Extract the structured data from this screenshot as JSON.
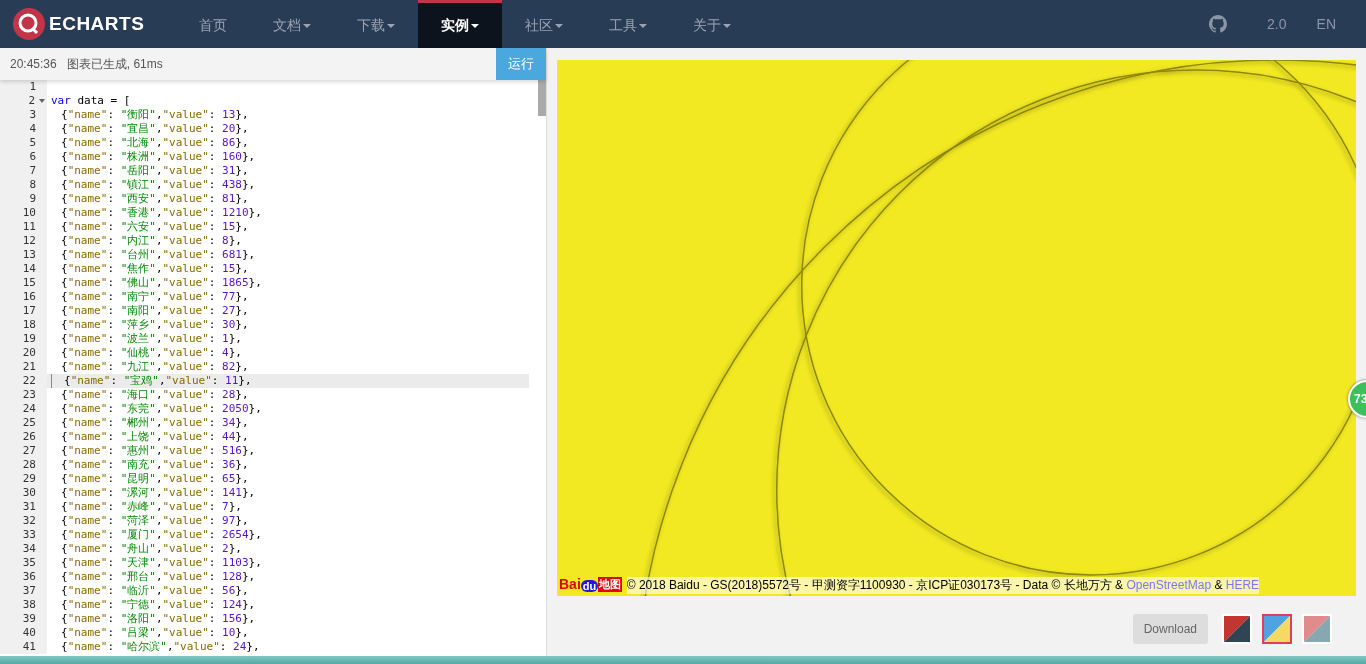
{
  "nav": {
    "logo": "ECHARTS",
    "items": [
      {
        "label": "首页",
        "dropdown": false,
        "selected": false
      },
      {
        "label": "文档",
        "dropdown": true,
        "selected": false
      },
      {
        "label": "下载",
        "dropdown": true,
        "selected": false
      },
      {
        "label": "实例",
        "dropdown": true,
        "selected": true
      },
      {
        "label": "社区",
        "dropdown": true,
        "selected": false
      },
      {
        "label": "工具",
        "dropdown": true,
        "selected": false
      },
      {
        "label": "关于",
        "dropdown": true,
        "selected": false
      }
    ],
    "version": "2.0",
    "language": "EN"
  },
  "status": {
    "time": "20:45:36",
    "message": "图表已生成, 61ms",
    "run_button": "运行"
  },
  "editor": {
    "lines": [
      {
        "n": "1",
        "active": false,
        "foldable": false
      },
      {
        "n": "2",
        "active": false,
        "foldable": true,
        "t": [
          {
            "kind": "keyword",
            "text": "var"
          },
          {
            "kind": "plain",
            "text": " data = ["
          }
        ]
      },
      {
        "n": "3",
        "active": false,
        "foldable": false,
        "t": [
          {
            "kind": "plain",
            "text": "{"
          },
          {
            "kind": "key",
            "text": "\"name\""
          },
          {
            "kind": "plain",
            "text": ": "
          },
          {
            "kind": "string",
            "text": "\"衡阳\""
          },
          {
            "kind": "plain",
            "text": ","
          },
          {
            "kind": "key",
            "text": "\"value\""
          },
          {
            "kind": "plain",
            "text": ": "
          },
          {
            "kind": "number",
            "text": "13"
          },
          {
            "kind": "plain",
            "text": "},"
          }
        ]
      },
      {
        "n": "4",
        "active": false,
        "foldable": false,
        "t": [
          {
            "kind": "plain",
            "text": "{"
          },
          {
            "kind": "key",
            "text": "\"name\""
          },
          {
            "kind": "plain",
            "text": ": "
          },
          {
            "kind": "string",
            "text": "\"宜昌\""
          },
          {
            "kind": "plain",
            "text": ","
          },
          {
            "kind": "key",
            "text": "\"value\""
          },
          {
            "kind": "plain",
            "text": ": "
          },
          {
            "kind": "number",
            "text": "20"
          },
          {
            "kind": "plain",
            "text": "},"
          }
        ]
      },
      {
        "n": "5",
        "active": false,
        "foldable": false,
        "t": [
          {
            "kind": "plain",
            "text": "{"
          },
          {
            "kind": "key",
            "text": "\"name\""
          },
          {
            "kind": "plain",
            "text": ": "
          },
          {
            "kind": "string",
            "text": "\"北海\""
          },
          {
            "kind": "plain",
            "text": ","
          },
          {
            "kind": "key",
            "text": "\"value\""
          },
          {
            "kind": "plain",
            "text": ": "
          },
          {
            "kind": "number",
            "text": "86"
          },
          {
            "kind": "plain",
            "text": "},"
          }
        ]
      },
      {
        "n": "6",
        "active": false,
        "foldable": false,
        "t": [
          {
            "kind": "plain",
            "text": "{"
          },
          {
            "kind": "key",
            "text": "\"name\""
          },
          {
            "kind": "plain",
            "text": ": "
          },
          {
            "kind": "string",
            "text": "\"株洲\""
          },
          {
            "kind": "plain",
            "text": ","
          },
          {
            "kind": "key",
            "text": "\"value\""
          },
          {
            "kind": "plain",
            "text": ": "
          },
          {
            "kind": "number",
            "text": "160"
          },
          {
            "kind": "plain",
            "text": "},"
          }
        ]
      },
      {
        "n": "7",
        "active": false,
        "foldable": false,
        "t": [
          {
            "kind": "plain",
            "text": "{"
          },
          {
            "kind": "key",
            "text": "\"name\""
          },
          {
            "kind": "plain",
            "text": ": "
          },
          {
            "kind": "string",
            "text": "\"岳阳\""
          },
          {
            "kind": "plain",
            "text": ","
          },
          {
            "kind": "key",
            "text": "\"value\""
          },
          {
            "kind": "plain",
            "text": ": "
          },
          {
            "kind": "number",
            "text": "31"
          },
          {
            "kind": "plain",
            "text": "},"
          }
        ]
      },
      {
        "n": "8",
        "active": false,
        "foldable": false,
        "t": [
          {
            "kind": "plain",
            "text": "{"
          },
          {
            "kind": "key",
            "text": "\"name\""
          },
          {
            "kind": "plain",
            "text": ": "
          },
          {
            "kind": "string",
            "text": "\"镇江\""
          },
          {
            "kind": "plain",
            "text": ","
          },
          {
            "kind": "key",
            "text": "\"value\""
          },
          {
            "kind": "plain",
            "text": ": "
          },
          {
            "kind": "number",
            "text": "438"
          },
          {
            "kind": "plain",
            "text": "},"
          }
        ]
      },
      {
        "n": "9",
        "active": false,
        "foldable": false,
        "t": [
          {
            "kind": "plain",
            "text": "{"
          },
          {
            "kind": "key",
            "text": "\"name\""
          },
          {
            "kind": "plain",
            "text": ": "
          },
          {
            "kind": "string",
            "text": "\"西安\""
          },
          {
            "kind": "plain",
            "text": ","
          },
          {
            "kind": "key",
            "text": "\"value\""
          },
          {
            "kind": "plain",
            "text": ": "
          },
          {
            "kind": "number",
            "text": "81"
          },
          {
            "kind": "plain",
            "text": "},"
          }
        ]
      },
      {
        "n": "10",
        "active": false,
        "foldable": false,
        "t": [
          {
            "kind": "plain",
            "text": "{"
          },
          {
            "kind": "key",
            "text": "\"name\""
          },
          {
            "kind": "plain",
            "text": ": "
          },
          {
            "kind": "string",
            "text": "\"香港\""
          },
          {
            "kind": "plain",
            "text": ","
          },
          {
            "kind": "key",
            "text": "\"value\""
          },
          {
            "kind": "plain",
            "text": ": "
          },
          {
            "kind": "number",
            "text": "1210"
          },
          {
            "kind": "plain",
            "text": "},"
          }
        ]
      },
      {
        "n": "11",
        "active": false,
        "foldable": false,
        "t": [
          {
            "kind": "plain",
            "text": "{"
          },
          {
            "kind": "key",
            "text": "\"name\""
          },
          {
            "kind": "plain",
            "text": ": "
          },
          {
            "kind": "string",
            "text": "\"六安\""
          },
          {
            "kind": "plain",
            "text": ","
          },
          {
            "kind": "key",
            "text": "\"value\""
          },
          {
            "kind": "plain",
            "text": ": "
          },
          {
            "kind": "number",
            "text": "15"
          },
          {
            "kind": "plain",
            "text": "},"
          }
        ]
      },
      {
        "n": "12",
        "active": false,
        "foldable": false,
        "t": [
          {
            "kind": "plain",
            "text": "{"
          },
          {
            "kind": "key",
            "text": "\"name\""
          },
          {
            "kind": "plain",
            "text": ": "
          },
          {
            "kind": "string",
            "text": "\"内江\""
          },
          {
            "kind": "plain",
            "text": ","
          },
          {
            "kind": "key",
            "text": "\"value\""
          },
          {
            "kind": "plain",
            "text": ": "
          },
          {
            "kind": "number",
            "text": "8"
          },
          {
            "kind": "plain",
            "text": "},"
          }
        ]
      },
      {
        "n": "13",
        "active": false,
        "foldable": false,
        "t": [
          {
            "kind": "plain",
            "text": "{"
          },
          {
            "kind": "key",
            "text": "\"name\""
          },
          {
            "kind": "plain",
            "text": ": "
          },
          {
            "kind": "string",
            "text": "\"台州\""
          },
          {
            "kind": "plain",
            "text": ","
          },
          {
            "kind": "key",
            "text": "\"value\""
          },
          {
            "kind": "plain",
            "text": ": "
          },
          {
            "kind": "number",
            "text": "681"
          },
          {
            "kind": "plain",
            "text": "},"
          }
        ]
      },
      {
        "n": "14",
        "active": false,
        "foldable": false,
        "t": [
          {
            "kind": "plain",
            "text": "{"
          },
          {
            "kind": "key",
            "text": "\"name\""
          },
          {
            "kind": "plain",
            "text": ": "
          },
          {
            "kind": "string",
            "text": "\"焦作\""
          },
          {
            "kind": "plain",
            "text": ","
          },
          {
            "kind": "key",
            "text": "\"value\""
          },
          {
            "kind": "plain",
            "text": ": "
          },
          {
            "kind": "number",
            "text": "15"
          },
          {
            "kind": "plain",
            "text": "},"
          }
        ]
      },
      {
        "n": "15",
        "active": false,
        "foldable": false,
        "t": [
          {
            "kind": "plain",
            "text": "{"
          },
          {
            "kind": "key",
            "text": "\"name\""
          },
          {
            "kind": "plain",
            "text": ": "
          },
          {
            "kind": "string",
            "text": "\"佛山\""
          },
          {
            "kind": "plain",
            "text": ","
          },
          {
            "kind": "key",
            "text": "\"value\""
          },
          {
            "kind": "plain",
            "text": ": "
          },
          {
            "kind": "number",
            "text": "1865"
          },
          {
            "kind": "plain",
            "text": "},"
          }
        ]
      },
      {
        "n": "16",
        "active": false,
        "foldable": false,
        "t": [
          {
            "kind": "plain",
            "text": "{"
          },
          {
            "kind": "key",
            "text": "\"name\""
          },
          {
            "kind": "plain",
            "text": ": "
          },
          {
            "kind": "string",
            "text": "\"南宁\""
          },
          {
            "kind": "plain",
            "text": ","
          },
          {
            "kind": "key",
            "text": "\"value\""
          },
          {
            "kind": "plain",
            "text": ": "
          },
          {
            "kind": "number",
            "text": "77"
          },
          {
            "kind": "plain",
            "text": "},"
          }
        ]
      },
      {
        "n": "17",
        "active": false,
        "foldable": false,
        "t": [
          {
            "kind": "plain",
            "text": "{"
          },
          {
            "kind": "key",
            "text": "\"name\""
          },
          {
            "kind": "plain",
            "text": ": "
          },
          {
            "kind": "string",
            "text": "\"南阳\""
          },
          {
            "kind": "plain",
            "text": ","
          },
          {
            "kind": "key",
            "text": "\"value\""
          },
          {
            "kind": "plain",
            "text": ": "
          },
          {
            "kind": "number",
            "text": "27"
          },
          {
            "kind": "plain",
            "text": "},"
          }
        ]
      },
      {
        "n": "18",
        "active": false,
        "foldable": false,
        "t": [
          {
            "kind": "plain",
            "text": "{"
          },
          {
            "kind": "key",
            "text": "\"name\""
          },
          {
            "kind": "plain",
            "text": ": "
          },
          {
            "kind": "string",
            "text": "\"萍乡\""
          },
          {
            "kind": "plain",
            "text": ","
          },
          {
            "kind": "key",
            "text": "\"value\""
          },
          {
            "kind": "plain",
            "text": ": "
          },
          {
            "kind": "number",
            "text": "30"
          },
          {
            "kind": "plain",
            "text": "},"
          }
        ]
      },
      {
        "n": "19",
        "active": false,
        "foldable": false,
        "t": [
          {
            "kind": "plain",
            "text": "{"
          },
          {
            "kind": "key",
            "text": "\"name\""
          },
          {
            "kind": "plain",
            "text": ": "
          },
          {
            "kind": "string",
            "text": "\"波兰\""
          },
          {
            "kind": "plain",
            "text": ","
          },
          {
            "kind": "key",
            "text": "\"value\""
          },
          {
            "kind": "plain",
            "text": ": "
          },
          {
            "kind": "number",
            "text": "1"
          },
          {
            "kind": "plain",
            "text": "},"
          }
        ]
      },
      {
        "n": "20",
        "active": false,
        "foldable": false,
        "t": [
          {
            "kind": "plain",
            "text": "{"
          },
          {
            "kind": "key",
            "text": "\"name\""
          },
          {
            "kind": "plain",
            "text": ": "
          },
          {
            "kind": "string",
            "text": "\"仙桃\""
          },
          {
            "kind": "plain",
            "text": ","
          },
          {
            "kind": "key",
            "text": "\"value\""
          },
          {
            "kind": "plain",
            "text": ": "
          },
          {
            "kind": "number",
            "text": "4"
          },
          {
            "kind": "plain",
            "text": "},"
          }
        ]
      },
      {
        "n": "21",
        "active": false,
        "foldable": false,
        "t": [
          {
            "kind": "plain",
            "text": "{"
          },
          {
            "kind": "key",
            "text": "\"name\""
          },
          {
            "kind": "plain",
            "text": ": "
          },
          {
            "kind": "string",
            "text": "\"九江\""
          },
          {
            "kind": "plain",
            "text": ","
          },
          {
            "kind": "key",
            "text": "\"value\""
          },
          {
            "kind": "plain",
            "text": ": "
          },
          {
            "kind": "number",
            "text": "82"
          },
          {
            "kind": "plain",
            "text": "},"
          }
        ]
      },
      {
        "n": "22",
        "active": true,
        "foldable": false,
        "t": [
          {
            "kind": "plain",
            "text": "{"
          },
          {
            "kind": "key",
            "text": "\"name\""
          },
          {
            "kind": "plain",
            "text": ": "
          },
          {
            "kind": "string",
            "text": "\"宝鸡\""
          },
          {
            "kind": "plain",
            "text": ","
          },
          {
            "kind": "key",
            "text": "\"value\""
          },
          {
            "kind": "plain",
            "text": ": "
          },
          {
            "kind": "number",
            "text": "11"
          },
          {
            "kind": "plain",
            "text": "},"
          }
        ]
      },
      {
        "n": "23",
        "active": false,
        "foldable": false,
        "t": [
          {
            "kind": "plain",
            "text": "{"
          },
          {
            "kind": "key",
            "text": "\"name\""
          },
          {
            "kind": "plain",
            "text": ": "
          },
          {
            "kind": "string",
            "text": "\"海口\""
          },
          {
            "kind": "plain",
            "text": ","
          },
          {
            "kind": "key",
            "text": "\"value\""
          },
          {
            "kind": "plain",
            "text": ": "
          },
          {
            "kind": "number",
            "text": "28"
          },
          {
            "kind": "plain",
            "text": "},"
          }
        ]
      },
      {
        "n": "24",
        "active": false,
        "foldable": false,
        "t": [
          {
            "kind": "plain",
            "text": "{"
          },
          {
            "kind": "key",
            "text": "\"name\""
          },
          {
            "kind": "plain",
            "text": ": "
          },
          {
            "kind": "string",
            "text": "\"东莞\""
          },
          {
            "kind": "plain",
            "text": ","
          },
          {
            "kind": "key",
            "text": "\"value\""
          },
          {
            "kind": "plain",
            "text": ": "
          },
          {
            "kind": "number",
            "text": "2050"
          },
          {
            "kind": "plain",
            "text": "},"
          }
        ]
      },
      {
        "n": "25",
        "active": false,
        "foldable": false,
        "t": [
          {
            "kind": "plain",
            "text": "{"
          },
          {
            "kind": "key",
            "text": "\"name\""
          },
          {
            "kind": "plain",
            "text": ": "
          },
          {
            "kind": "string",
            "text": "\"郴州\""
          },
          {
            "kind": "plain",
            "text": ","
          },
          {
            "kind": "key",
            "text": "\"value\""
          },
          {
            "kind": "plain",
            "text": ": "
          },
          {
            "kind": "number",
            "text": "34"
          },
          {
            "kind": "plain",
            "text": "},"
          }
        ]
      },
      {
        "n": "26",
        "active": false,
        "foldable": false,
        "t": [
          {
            "kind": "plain",
            "text": "{"
          },
          {
            "kind": "key",
            "text": "\"name\""
          },
          {
            "kind": "plain",
            "text": ": "
          },
          {
            "kind": "string",
            "text": "\"上饶\""
          },
          {
            "kind": "plain",
            "text": ","
          },
          {
            "kind": "key",
            "text": "\"value\""
          },
          {
            "kind": "plain",
            "text": ": "
          },
          {
            "kind": "number",
            "text": "44"
          },
          {
            "kind": "plain",
            "text": "},"
          }
        ]
      },
      {
        "n": "27",
        "active": false,
        "foldable": false,
        "t": [
          {
            "kind": "plain",
            "text": "{"
          },
          {
            "kind": "key",
            "text": "\"name\""
          },
          {
            "kind": "plain",
            "text": ": "
          },
          {
            "kind": "string",
            "text": "\"惠州\""
          },
          {
            "kind": "plain",
            "text": ","
          },
          {
            "kind": "key",
            "text": "\"value\""
          },
          {
            "kind": "plain",
            "text": ": "
          },
          {
            "kind": "number",
            "text": "516"
          },
          {
            "kind": "plain",
            "text": "},"
          }
        ]
      },
      {
        "n": "28",
        "active": false,
        "foldable": false,
        "t": [
          {
            "kind": "plain",
            "text": "{"
          },
          {
            "kind": "key",
            "text": "\"name\""
          },
          {
            "kind": "plain",
            "text": ": "
          },
          {
            "kind": "string",
            "text": "\"南充\""
          },
          {
            "kind": "plain",
            "text": ","
          },
          {
            "kind": "key",
            "text": "\"value\""
          },
          {
            "kind": "plain",
            "text": ": "
          },
          {
            "kind": "number",
            "text": "36"
          },
          {
            "kind": "plain",
            "text": "},"
          }
        ]
      },
      {
        "n": "29",
        "active": false,
        "foldable": false,
        "t": [
          {
            "kind": "plain",
            "text": "{"
          },
          {
            "kind": "key",
            "text": "\"name\""
          },
          {
            "kind": "plain",
            "text": ": "
          },
          {
            "kind": "string",
            "text": "\"昆明\""
          },
          {
            "kind": "plain",
            "text": ","
          },
          {
            "kind": "key",
            "text": "\"value\""
          },
          {
            "kind": "plain",
            "text": ": "
          },
          {
            "kind": "number",
            "text": "65"
          },
          {
            "kind": "plain",
            "text": "},"
          }
        ]
      },
      {
        "n": "30",
        "active": false,
        "foldable": false,
        "t": [
          {
            "kind": "plain",
            "text": "{"
          },
          {
            "kind": "key",
            "text": "\"name\""
          },
          {
            "kind": "plain",
            "text": ": "
          },
          {
            "kind": "string",
            "text": "\"漯河\""
          },
          {
            "kind": "plain",
            "text": ","
          },
          {
            "kind": "key",
            "text": "\"value\""
          },
          {
            "kind": "plain",
            "text": ": "
          },
          {
            "kind": "number",
            "text": "141"
          },
          {
            "kind": "plain",
            "text": "},"
          }
        ]
      },
      {
        "n": "31",
        "active": false,
        "foldable": false,
        "t": [
          {
            "kind": "plain",
            "text": "{"
          },
          {
            "kind": "key",
            "text": "\"name\""
          },
          {
            "kind": "plain",
            "text": ": "
          },
          {
            "kind": "string",
            "text": "\"赤峰\""
          },
          {
            "kind": "plain",
            "text": ","
          },
          {
            "kind": "key",
            "text": "\"value\""
          },
          {
            "kind": "plain",
            "text": ": "
          },
          {
            "kind": "number",
            "text": "7"
          },
          {
            "kind": "plain",
            "text": "},"
          }
        ]
      },
      {
        "n": "32",
        "active": false,
        "foldable": false,
        "t": [
          {
            "kind": "plain",
            "text": "{"
          },
          {
            "kind": "key",
            "text": "\"name\""
          },
          {
            "kind": "plain",
            "text": ": "
          },
          {
            "kind": "string",
            "text": "\"菏泽\""
          },
          {
            "kind": "plain",
            "text": ","
          },
          {
            "kind": "key",
            "text": "\"value\""
          },
          {
            "kind": "plain",
            "text": ": "
          },
          {
            "kind": "number",
            "text": "97"
          },
          {
            "kind": "plain",
            "text": "},"
          }
        ]
      },
      {
        "n": "33",
        "active": false,
        "foldable": false,
        "t": [
          {
            "kind": "plain",
            "text": "{"
          },
          {
            "kind": "key",
            "text": "\"name\""
          },
          {
            "kind": "plain",
            "text": ": "
          },
          {
            "kind": "string",
            "text": "\"厦门\""
          },
          {
            "kind": "plain",
            "text": ","
          },
          {
            "kind": "key",
            "text": "\"value\""
          },
          {
            "kind": "plain",
            "text": ": "
          },
          {
            "kind": "number",
            "text": "2654"
          },
          {
            "kind": "plain",
            "text": "},"
          }
        ]
      },
      {
        "n": "34",
        "active": false,
        "foldable": false,
        "t": [
          {
            "kind": "plain",
            "text": "{"
          },
          {
            "kind": "key",
            "text": "\"name\""
          },
          {
            "kind": "plain",
            "text": ": "
          },
          {
            "kind": "string",
            "text": "\"舟山\""
          },
          {
            "kind": "plain",
            "text": ","
          },
          {
            "kind": "key",
            "text": "\"value\""
          },
          {
            "kind": "plain",
            "text": ": "
          },
          {
            "kind": "number",
            "text": "2"
          },
          {
            "kind": "plain",
            "text": "},"
          }
        ]
      },
      {
        "n": "35",
        "active": false,
        "foldable": false,
        "t": [
          {
            "kind": "plain",
            "text": "{"
          },
          {
            "kind": "key",
            "text": "\"name\""
          },
          {
            "kind": "plain",
            "text": ": "
          },
          {
            "kind": "string",
            "text": "\"天津\""
          },
          {
            "kind": "plain",
            "text": ","
          },
          {
            "kind": "key",
            "text": "\"value\""
          },
          {
            "kind": "plain",
            "text": ": "
          },
          {
            "kind": "number",
            "text": "1103"
          },
          {
            "kind": "plain",
            "text": "},"
          }
        ]
      },
      {
        "n": "36",
        "active": false,
        "foldable": false,
        "t": [
          {
            "kind": "plain",
            "text": "{"
          },
          {
            "kind": "key",
            "text": "\"name\""
          },
          {
            "kind": "plain",
            "text": ": "
          },
          {
            "kind": "string",
            "text": "\"邢台\""
          },
          {
            "kind": "plain",
            "text": ","
          },
          {
            "kind": "key",
            "text": "\"value\""
          },
          {
            "kind": "plain",
            "text": ": "
          },
          {
            "kind": "number",
            "text": "128"
          },
          {
            "kind": "plain",
            "text": "},"
          }
        ]
      },
      {
        "n": "37",
        "active": false,
        "foldable": false,
        "t": [
          {
            "kind": "plain",
            "text": "{"
          },
          {
            "kind": "key",
            "text": "\"name\""
          },
          {
            "kind": "plain",
            "text": ": "
          },
          {
            "kind": "string",
            "text": "\"临沂\""
          },
          {
            "kind": "plain",
            "text": ","
          },
          {
            "kind": "key",
            "text": "\"value\""
          },
          {
            "kind": "plain",
            "text": ": "
          },
          {
            "kind": "number",
            "text": "56"
          },
          {
            "kind": "plain",
            "text": "},"
          }
        ]
      },
      {
        "n": "38",
        "active": false,
        "foldable": false,
        "t": [
          {
            "kind": "plain",
            "text": "{"
          },
          {
            "kind": "key",
            "text": "\"name\""
          },
          {
            "kind": "plain",
            "text": ": "
          },
          {
            "kind": "string",
            "text": "\"宁德\""
          },
          {
            "kind": "plain",
            "text": ","
          },
          {
            "kind": "key",
            "text": "\"value\""
          },
          {
            "kind": "plain",
            "text": ": "
          },
          {
            "kind": "number",
            "text": "124"
          },
          {
            "kind": "plain",
            "text": "},"
          }
        ]
      },
      {
        "n": "39",
        "active": false,
        "foldable": false,
        "t": [
          {
            "kind": "plain",
            "text": "{"
          },
          {
            "kind": "key",
            "text": "\"name\""
          },
          {
            "kind": "plain",
            "text": ": "
          },
          {
            "kind": "string",
            "text": "\"洛阳\""
          },
          {
            "kind": "plain",
            "text": ","
          },
          {
            "kind": "key",
            "text": "\"value\""
          },
          {
            "kind": "plain",
            "text": ": "
          },
          {
            "kind": "number",
            "text": "156"
          },
          {
            "kind": "plain",
            "text": "},"
          }
        ]
      },
      {
        "n": "40",
        "active": false,
        "foldable": false,
        "t": [
          {
            "kind": "plain",
            "text": "{"
          },
          {
            "kind": "key",
            "text": "\"name\""
          },
          {
            "kind": "plain",
            "text": ": "
          },
          {
            "kind": "string",
            "text": "\"吕梁\""
          },
          {
            "kind": "plain",
            "text": ","
          },
          {
            "kind": "key",
            "text": "\"value\""
          },
          {
            "kind": "plain",
            "text": ": "
          },
          {
            "kind": "number",
            "text": "10"
          },
          {
            "kind": "plain",
            "text": "},"
          }
        ]
      },
      {
        "n": "41",
        "active": false,
        "foldable": false,
        "t": [
          {
            "kind": "plain",
            "text": "{"
          },
          {
            "kind": "key",
            "text": "\"name\""
          },
          {
            "kind": "plain",
            "text": ": "
          },
          {
            "kind": "string",
            "text": "\"哈尔滨\""
          },
          {
            "kind": "plain",
            "text": ","
          },
          {
            "kind": "key",
            "text": "\"value\""
          },
          {
            "kind": "plain",
            "text": ": "
          },
          {
            "kind": "number",
            "text": "24"
          },
          {
            "kind": "plain",
            "text": "},"
          }
        ]
      }
    ]
  },
  "map": {
    "logo": [
      "Bai",
      "du",
      "地图"
    ],
    "attribution": "© 2018 Baidu - GS(2018)5572号 - 甲测资字1100930 - 京ICP证030173号 - Data © 长地万方 & ",
    "links": [
      "OpenStreetMap",
      "HERE"
    ],
    "link_separator": " & "
  },
  "badge": "73",
  "footer": {
    "download": "Download",
    "themes": [
      {
        "halves": [
          {
            "color": "#c23531"
          },
          {
            "color": "#2f4554"
          }
        ],
        "selected": false
      },
      {
        "halves": [
          {
            "color": "#4ea3e0"
          },
          {
            "color": "#f6d965"
          }
        ],
        "selected": true
      },
      {
        "halves": [
          {
            "color": "#e08c8c"
          },
          {
            "color": "#86a8ae"
          }
        ],
        "selected": false
      }
    ]
  }
}
